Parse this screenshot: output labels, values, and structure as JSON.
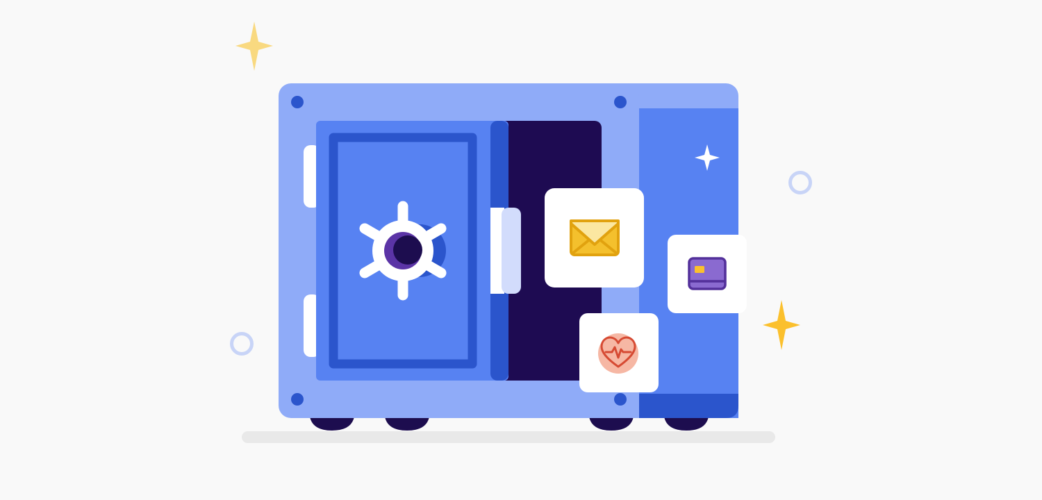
{
  "illustration": {
    "subject": "safe-vault",
    "icons": [
      "sparkle-icon",
      "ring-icon",
      "safe-icon",
      "dial-icon",
      "envelope-icon",
      "credit-card-icon",
      "heart-pulse-icon"
    ]
  },
  "colors": {
    "background": "#f9f9f9",
    "safe_body": "#8fabf8",
    "safe_side": "#5782f2",
    "safe_dark": "#2b55cc",
    "interior": "#1e0b52",
    "ink": "#1d0d4f",
    "door_face": "#5782f2",
    "white": "#ffffff",
    "hinge_light": "#d2dcfc",
    "ring": "#c8d4f7",
    "spark_yellow": "#fbc02d",
    "spark_pale": "#f9d980",
    "envelope": "#f4c02d",
    "envelope_stroke": "#e1a20f",
    "card_purple": "#8a6ad0",
    "card_stroke": "#53309a",
    "card_chip": "#fbc02d",
    "heart_circle": "#f6b7a4",
    "heart_stroke": "#d64a33",
    "shadow": "#e9e9e9"
  }
}
